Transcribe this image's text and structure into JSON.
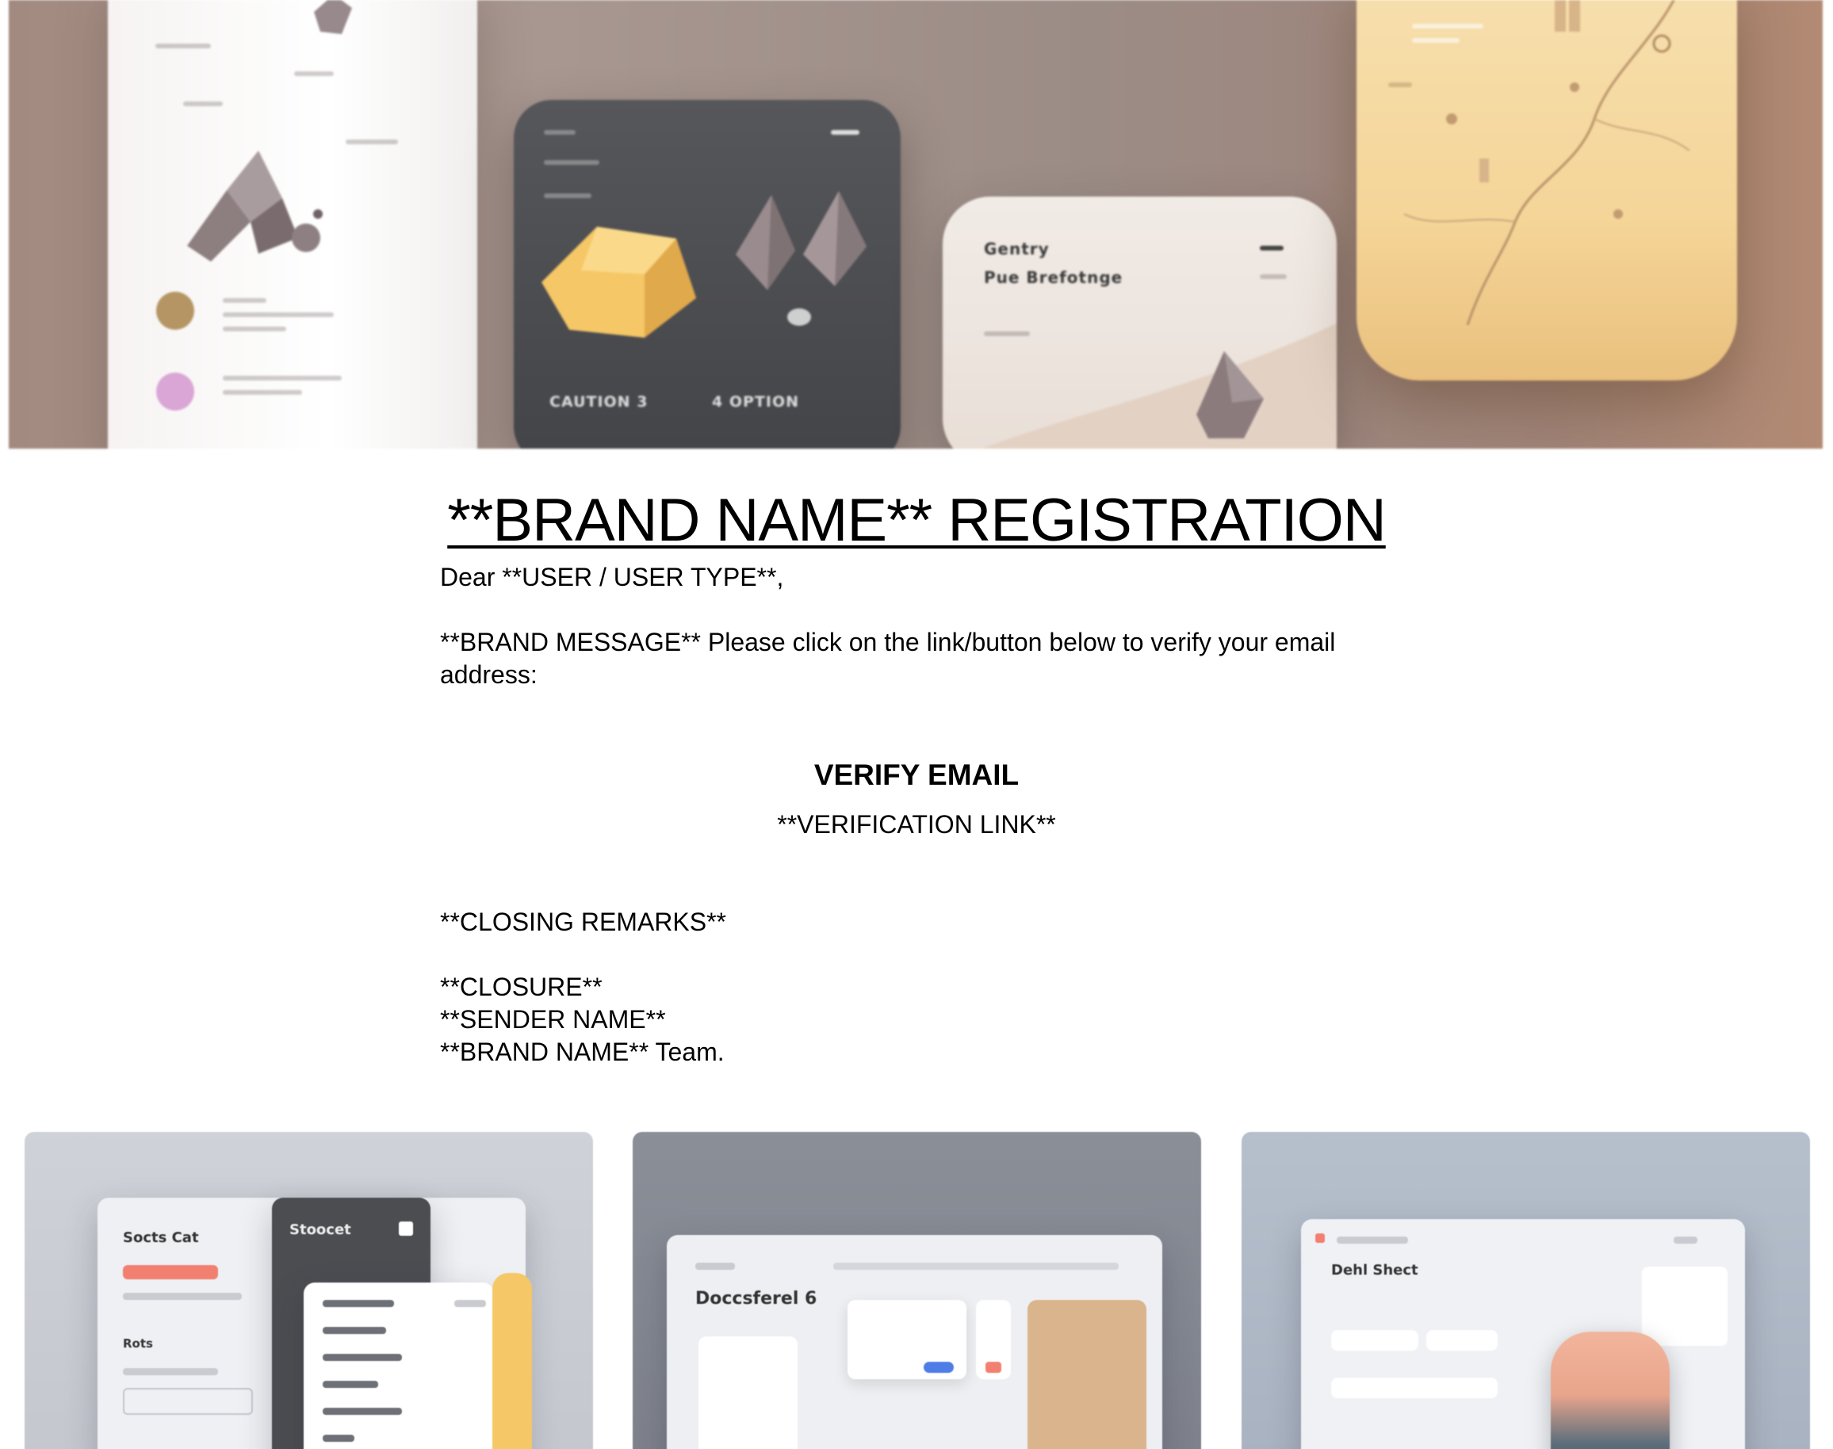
{
  "hero": {
    "image_name": "ui-mockups-hero-illustration",
    "panel_text": {
      "dark_footer_left": "CAUTION 3",
      "dark_footer_right": "4 OPTION",
      "light_title_1": "Gentry",
      "light_title_2": "Pue Brefotnge"
    }
  },
  "email": {
    "title": "**BRAND NAME** REGISTRATION",
    "greeting": "Dear **USER / USER TYPE**,",
    "message": "**BRAND MESSAGE** Please click on the link/button below to verify your email address:",
    "verify_button": "VERIFY EMAIL",
    "verification_link": "**VERIFICATION LINK**",
    "closing_remarks": "**CLOSING REMARKS**",
    "closure": "**CLOSURE**",
    "sender_name": "**SENDER NAME**",
    "team_signature": "**BRAND NAME** Team."
  },
  "gallery": {
    "cards": [
      {
        "name": "dashboard-mockup-1",
        "heading": "Socts Cat",
        "sub": "Stoocet"
      },
      {
        "name": "dashboard-mockup-2",
        "heading": "Doccsferel 6"
      },
      {
        "name": "dashboard-mockup-3",
        "heading": "Dehl Shect"
      }
    ]
  },
  "colors": {
    "accent_gold": "#f5d598",
    "dark_panel": "#4c4d51",
    "coral": "#f28070",
    "blue": "#4f7de8"
  }
}
